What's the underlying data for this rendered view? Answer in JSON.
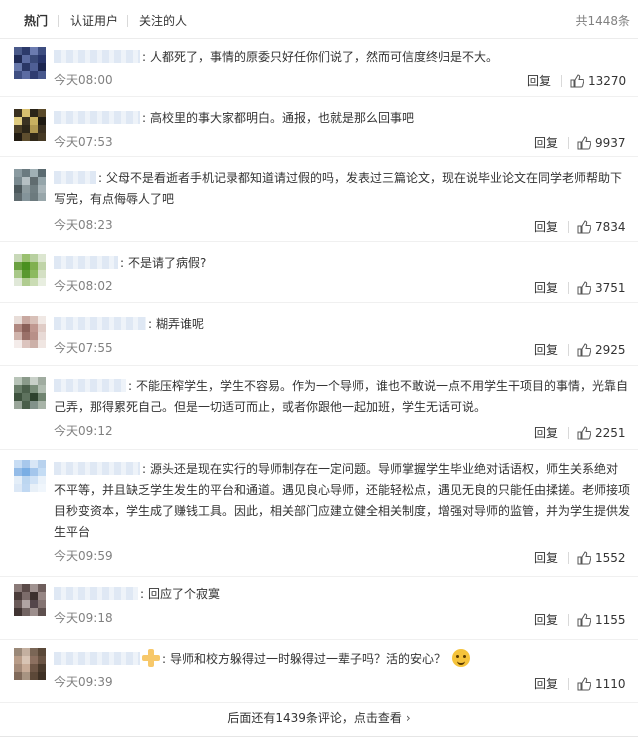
{
  "tabs": [
    {
      "label": "热门"
    },
    {
      "label": "认证用户"
    },
    {
      "label": "关注的人"
    }
  ],
  "total": "共1448条",
  "reply_label": "回复",
  "comments": [
    {
      "text": "人都死了，事情的原委只好任你们说了，然而可信度终归是不大。",
      "time": "今天08:00",
      "likes": "13270"
    },
    {
      "text": "高校里的事大家都明白。通报，也就是那么回事吧",
      "time": "今天07:53",
      "likes": "9937"
    },
    {
      "text": "父母不是看逝者手机记录都知道请过假的吗，发表过三篇论文，现在说毕业论文在同学老师帮助下写完，有点侮辱人了吧",
      "time": "今天08:23",
      "likes": "7834"
    },
    {
      "text": "不是请了病假?",
      "time": "今天08:02",
      "likes": "3751"
    },
    {
      "text": "糊弄谁呢",
      "time": "今天07:55",
      "likes": "2925"
    },
    {
      "text": "不能压榨学生，学生不容易。作为一个导师，谁也不敢说一点不用学生干项目的事情，光靠自己弄，那得累死自己。但是一切适可而止，或者你跟他一起加班，学生无话可说。",
      "time": "今天09:12",
      "likes": "2251"
    },
    {
      "text": "源头还是现在实行的导师制存在一定问题。导师掌握学生毕业绝对话语权，师生关系绝对不平等，并且缺乏学生发生的平台和通道。遇见良心导师，还能轻松点，遇见无良的只能任由揉搓。老师接项目秒变资本，学生成了赚钱工具。因此，相关部门应建立健全相关制度，增强对导师的监管，并为学生提供发生平台",
      "time": "今天09:59",
      "likes": "1552"
    },
    {
      "text": "回应了个寂寞",
      "time": "今天09:18",
      "likes": "1155"
    },
    {
      "text": "导师和校方躲得过一时躲得过一辈子吗？活的安心？",
      "time": "今天09:39",
      "likes": "1110"
    }
  ],
  "more": {
    "label": "后面还有1439条评论，点击查看",
    "icon": "chevron-right-icon"
  }
}
